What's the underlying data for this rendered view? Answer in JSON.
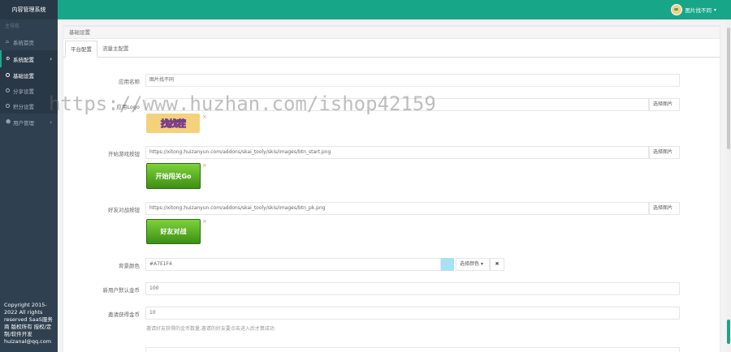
{
  "app": {
    "title": "内容管理系统"
  },
  "sidebar": {
    "head": "主导航",
    "items": [
      {
        "icon": "home-icon",
        "label": "系统首页"
      },
      {
        "icon": "cog-icon",
        "label": "系统配置"
      },
      {
        "icon": "user-icon",
        "label": "用户管理"
      }
    ],
    "sub_items": [
      "基础设置",
      "分享设置",
      "积分设置"
    ],
    "copyright": "Copyright 2015-2022 All rights reserved SaaS服务商 版权所有 授权/定制/软件开发 huizanal@qq.com"
  },
  "user": {
    "name": "图片找不同"
  },
  "panel": {
    "title": "基础设置"
  },
  "tabs": [
    "平台配置",
    "流量主配置"
  ],
  "form": {
    "app_name_label": "应用名称",
    "app_name_value": "图片找不同",
    "logo_label": "应用Logo",
    "logo_btn": "选择图片",
    "logo_img_text": "找找茬",
    "start_btn_label": "开始游戏按钮",
    "start_btn_value": "https://xitong.huizanyun.com/addons/skai_tooly/skis/images/btn_start.png",
    "start_btn_btn": "选择图片",
    "start_img_text": "开始闯关Go",
    "friend_btn_label": "好友对战按钮",
    "friend_btn_value": "https://xitong.huizanyun.com/addons/skai_tooly/skis/images/btn_pk.png",
    "friend_btn_btn": "选择图片",
    "friend_img_text": "好友对战",
    "bg_color_label": "背景颜色",
    "bg_color_value": "#A7E1F4",
    "bg_color_btn": "选择颜色 ▾",
    "bg_color_clear": "✖",
    "new_user_label": "新用户默认金币",
    "new_user_value": "100",
    "invite_label": "邀请获得金币",
    "invite_value": "10",
    "invite_hint": "邀请好友获得的金币数量,邀请的好友要点击进入后才算成功",
    "close_mark": "×"
  },
  "watermark": "https://www.huzhan.com/ishop42159",
  "colors": {
    "topbar": "#18a689",
    "sidebar": "#2f4050",
    "swatch": "#A7E1F4"
  }
}
